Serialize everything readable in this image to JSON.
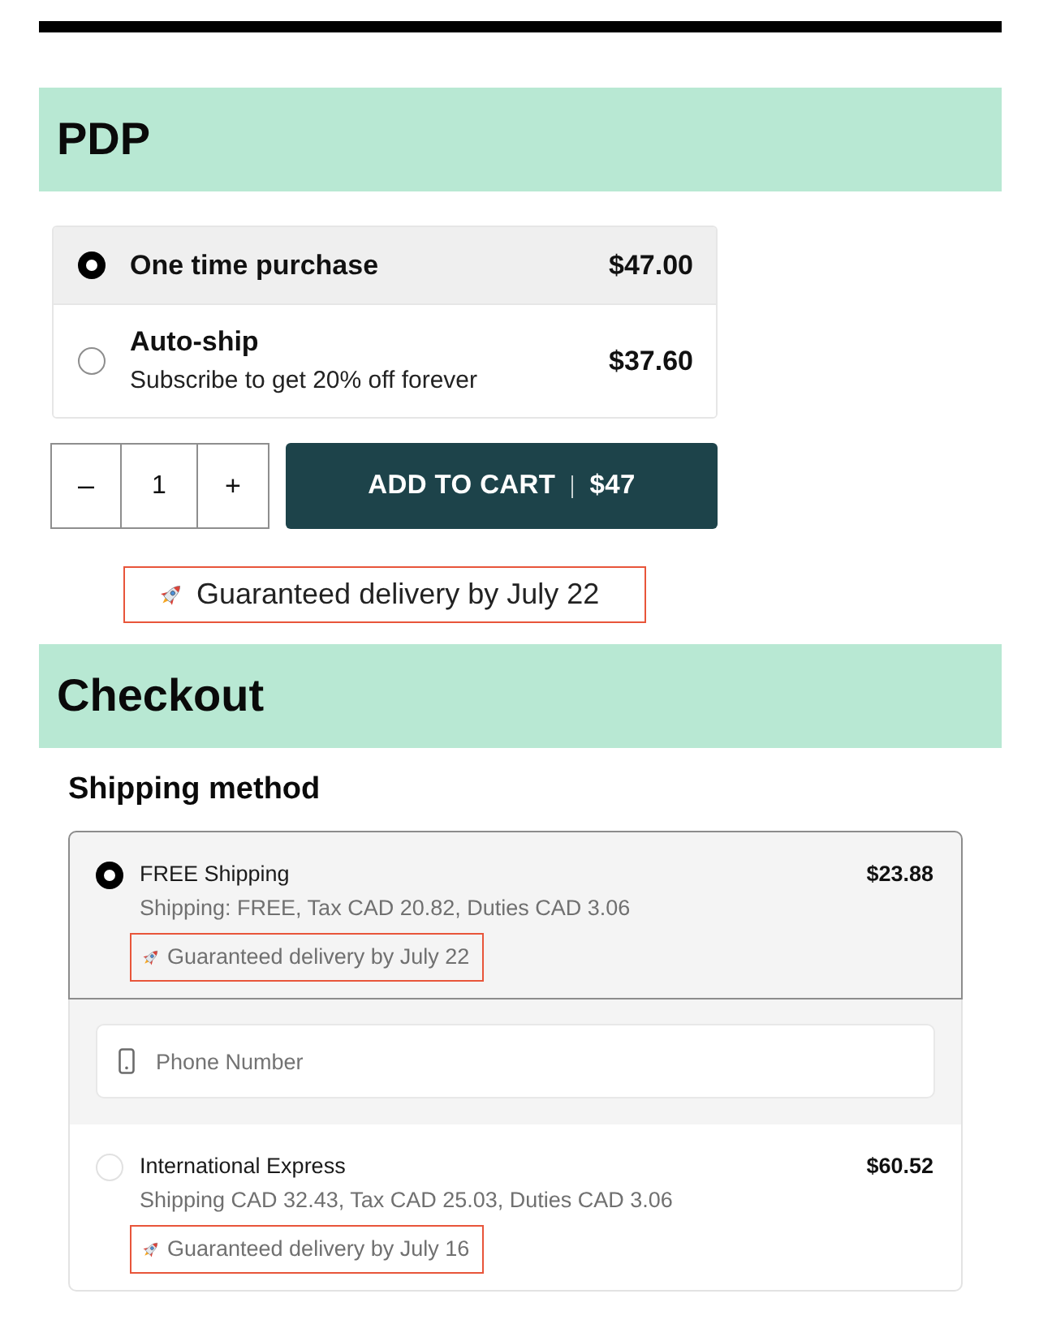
{
  "pdp": {
    "heading": "PDP",
    "purchase_options": [
      {
        "label": "One time purchase",
        "price": "$47.00",
        "selected": true
      },
      {
        "label": "Auto-ship",
        "description": "Subscribe to get 20% off forever",
        "price": "$37.60",
        "selected": false
      }
    ],
    "quantity": {
      "decrement": "–",
      "value": "1",
      "increment": "+"
    },
    "add_to_cart": {
      "label": "ADD TO CART",
      "price": "$47"
    },
    "delivery_note": "Guaranteed delivery by July 22"
  },
  "checkout": {
    "heading": "Checkout",
    "shipping_heading": "Shipping method",
    "shipping_options": [
      {
        "name": "FREE Shipping",
        "price": "$23.88",
        "details": "Shipping: FREE, Tax CAD 20.82, Duties CAD 3.06",
        "delivery_note": "Guaranteed delivery by July 22",
        "selected": true,
        "phone_field": {
          "placeholder": "Phone Number"
        }
      },
      {
        "name": "International Express",
        "price": "$60.52",
        "details": "Shipping CAD 32.43, Tax CAD 25.03, Duties CAD 3.06",
        "delivery_note": "Guaranteed delivery by July 16",
        "selected": false
      }
    ]
  }
}
